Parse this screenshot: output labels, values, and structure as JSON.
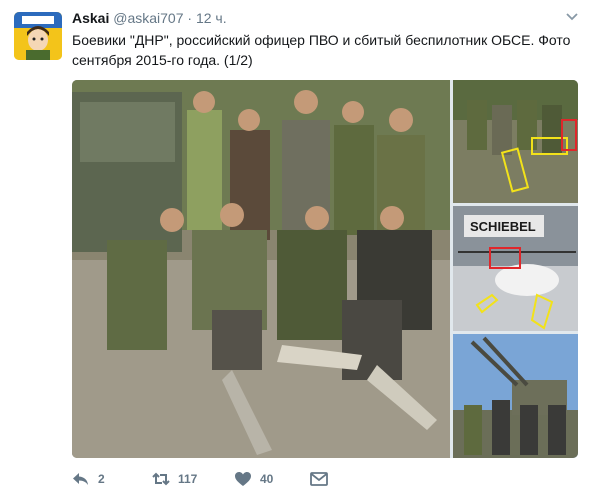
{
  "author": {
    "name": "Askai",
    "handle": "@askai707",
    "separator": "·",
    "time": "12 ч."
  },
  "tweet": {
    "text": "Боевики \"ДНР\", российский офицер ПВО и сбитый беспилотник ОБСЕ. Фото сентября 2015-го года. (1/2)"
  },
  "media": {
    "sign_text": "SCHIEBEL",
    "photo_count": 4
  },
  "actions": {
    "reply_count": "2",
    "retweet_count": "117",
    "like_count": "40"
  },
  "colors": {
    "retweet": "#657786",
    "highlight_boxes": "#f2e21a",
    "highlight_red": "#e0262a"
  }
}
